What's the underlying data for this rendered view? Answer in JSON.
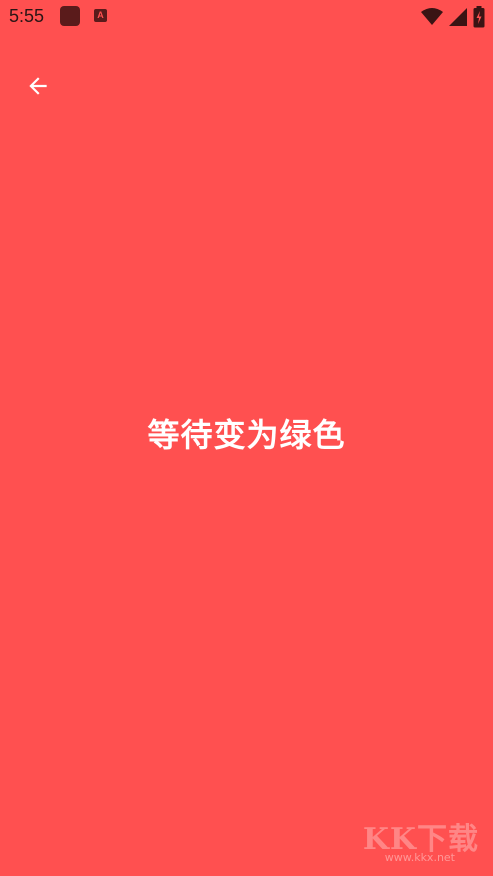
{
  "status_bar": {
    "time": "5:55",
    "notification_icons": [
      "app-notification-icon",
      "a-badge-icon"
    ],
    "a_badge_label": "A",
    "system_icons": [
      "wifi-icon",
      "signal-icon",
      "battery-icon"
    ]
  },
  "toolbar": {
    "back_icon": "arrow-left-icon"
  },
  "main": {
    "message": "等待变为绿色",
    "background_color": "#ff5050",
    "text_color": "#ffffff"
  },
  "watermark": {
    "main": "KK下载",
    "sub": "www.kkx.net"
  }
}
